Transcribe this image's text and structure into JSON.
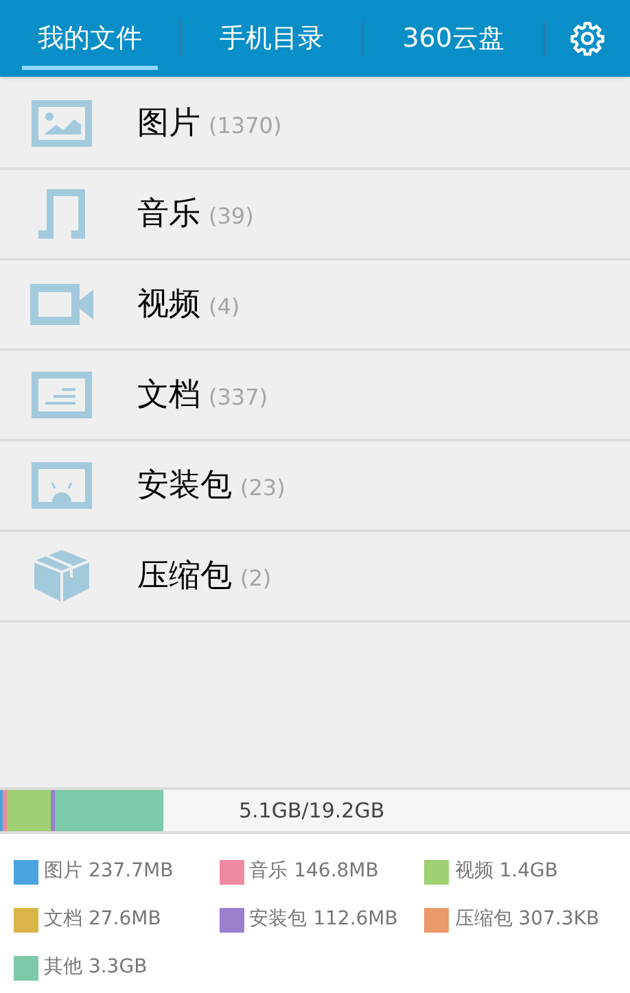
{
  "tabs": [
    {
      "label": "我的文件",
      "selected": true
    },
    {
      "label": "手机目录",
      "selected": false
    },
    {
      "label": "360云盘",
      "selected": false
    }
  ],
  "categories": [
    {
      "kind": "image",
      "name": "图片",
      "count": "(1370)"
    },
    {
      "kind": "music",
      "name": "音乐",
      "count": "(39)"
    },
    {
      "kind": "video",
      "name": "视频",
      "count": "(4)"
    },
    {
      "kind": "document",
      "name": "文档",
      "count": "(337)"
    },
    {
      "kind": "apk",
      "name": "安装包",
      "count": "(23)"
    },
    {
      "kind": "archive",
      "name": "压缩包",
      "count": "(2)"
    }
  ],
  "storage_bar": {
    "segments": [
      {
        "color": "#4aa3df",
        "level": 0.005
      },
      {
        "color": "#ee8aa0",
        "level": 0.006
      },
      {
        "color": "#9fd072",
        "level": 0.07
      },
      {
        "color": "#9a7fcf",
        "level": 0.006
      },
      {
        "color": "#7ccaa9",
        "level": 0.172
      }
    ],
    "reading": "5.1GB/19.2GB"
  },
  "legend": [
    {
      "label": "图片 237.7MB",
      "color": "#4aa3df"
    },
    {
      "label": "音乐 146.8MB",
      "color": "#ee8aa0"
    },
    {
      "label": "视频 1.4GB",
      "color": "#9fd072"
    },
    {
      "label": "文档 27.6MB",
      "color": "#d9b548"
    },
    {
      "label": "安装包 112.6MB",
      "color": "#9a7fcf"
    },
    {
      "label": "压缩包 307.3KB",
      "color": "#eb9a6a"
    },
    {
      "label": "其他 3.3GB",
      "color": "#7ccaa9"
    }
  ]
}
